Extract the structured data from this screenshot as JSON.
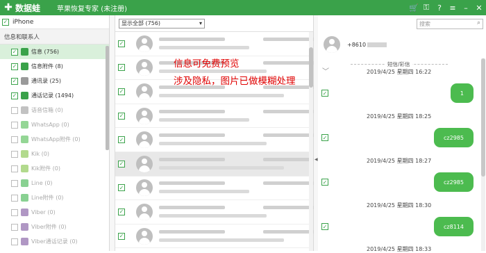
{
  "titlebar": {
    "logo": "✚",
    "brand": "数据蛙",
    "title": "苹果恢复专家 (未注册)",
    "icons": [
      "cart-icon",
      "key-icon",
      "help-icon",
      "menu-icon",
      "minimize-icon",
      "close-icon"
    ]
  },
  "sidebar": {
    "device": "iPhone",
    "section": "信息和联系人",
    "items": [
      {
        "label": "信息 (756)",
        "checked": true,
        "icon": "message-icon",
        "color": "#3aa24a",
        "active": true,
        "disabled": false
      },
      {
        "label": "信息附件 (8)",
        "checked": true,
        "icon": "attachment-icon",
        "color": "#3aa24a",
        "active": false,
        "disabled": false
      },
      {
        "label": "通讯录 (25)",
        "checked": true,
        "icon": "contacts-icon",
        "color": "#9a9a9a",
        "active": false,
        "disabled": false
      },
      {
        "label": "通话记录 (1494)",
        "checked": true,
        "icon": "call-log-icon",
        "color": "#3aa24a",
        "active": false,
        "disabled": false
      },
      {
        "label": "语音信箱 (0)",
        "checked": false,
        "icon": "voicemail-icon",
        "color": "#9a9a9a",
        "active": false,
        "disabled": true
      },
      {
        "label": "WhatsApp (0)",
        "checked": false,
        "icon": "whatsapp-icon",
        "color": "#4cbb4f",
        "active": false,
        "disabled": true
      },
      {
        "label": "WhatsApp附件 (0)",
        "checked": false,
        "icon": "whatsapp-icon",
        "color": "#4cbb4f",
        "active": false,
        "disabled": true
      },
      {
        "label": "Kik (0)",
        "checked": false,
        "icon": "kik-icon",
        "color": "#7fc241",
        "active": false,
        "disabled": true
      },
      {
        "label": "Kik附件 (0)",
        "checked": false,
        "icon": "kik-icon",
        "color": "#7fc241",
        "active": false,
        "disabled": true
      },
      {
        "label": "Line (0)",
        "checked": false,
        "icon": "line-icon",
        "color": "#3ab34a",
        "active": false,
        "disabled": true
      },
      {
        "label": "Line附件 (0)",
        "checked": false,
        "icon": "line-icon",
        "color": "#3ab34a",
        "active": false,
        "disabled": true
      },
      {
        "label": "Viber (0)",
        "checked": false,
        "icon": "viber-icon",
        "color": "#7b519d",
        "active": false,
        "disabled": true
      },
      {
        "label": "Viber附件 (0)",
        "checked": false,
        "icon": "viber-icon",
        "color": "#7b519d",
        "active": false,
        "disabled": true
      },
      {
        "label": "Viber通话记录 (0)",
        "checked": false,
        "icon": "viber-icon",
        "color": "#7b519d",
        "active": false,
        "disabled": true
      }
    ]
  },
  "filter": {
    "selected": "显示全部 (756)"
  },
  "message_list": {
    "count_rows": 9,
    "selected_index": 5,
    "rows_checked": [
      true,
      true,
      true,
      true,
      true,
      true,
      true,
      true,
      true
    ]
  },
  "overlay": {
    "line1": "信息可免费预览",
    "line2": "涉及隐私，图片已做模糊处理"
  },
  "search": {
    "placeholder": "搜索"
  },
  "conversation": {
    "number_prefix": "+8610",
    "section_label": "短信/彩信",
    "messages": [
      {
        "time": "2019/4/25 星期四 16:22",
        "text": "1"
      },
      {
        "time": "2019/4/25 星期四 18:25",
        "text": "cz2985"
      },
      {
        "time": "2019/4/25 星期四 18:27",
        "text": "cz2985"
      },
      {
        "time": "2019/4/25 星期四 18:30",
        "text": "cz8114"
      },
      {
        "time": "2019/4/25 星期四 18:33",
        "text": ""
      }
    ]
  },
  "colors": {
    "accent": "#3aa24a",
    "bubble": "#4cbb4f",
    "overlay_text": "#e00000"
  }
}
